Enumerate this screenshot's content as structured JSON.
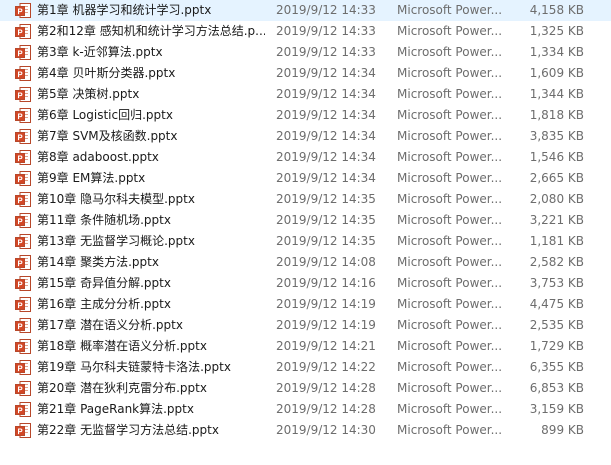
{
  "files": [
    {
      "name": "第1章 机器学习和统计学习.pptx",
      "date": "2019/9/12 14:33",
      "type": "Microsoft Power...",
      "size": "4,158 KB"
    },
    {
      "name": "第2和12章 感知机和统计学习方法总结.p...",
      "date": "2019/9/12 14:33",
      "type": "Microsoft Power...",
      "size": "1,325 KB"
    },
    {
      "name": "第3章 k-近邻算法.pptx",
      "date": "2019/9/12 14:33",
      "type": "Microsoft Power...",
      "size": "1,334 KB"
    },
    {
      "name": "第4章 贝叶斯分类器.pptx",
      "date": "2019/9/12 14:34",
      "type": "Microsoft Power...",
      "size": "1,609 KB"
    },
    {
      "name": "第5章 决策树.pptx",
      "date": "2019/9/12 14:34",
      "type": "Microsoft Power...",
      "size": "1,344 KB"
    },
    {
      "name": "第6章 Logistic回归.pptx",
      "date": "2019/9/12 14:34",
      "type": "Microsoft Power...",
      "size": "1,818 KB"
    },
    {
      "name": "第7章 SVM及核函数.pptx",
      "date": "2019/9/12 14:34",
      "type": "Microsoft Power...",
      "size": "3,835 KB"
    },
    {
      "name": "第8章 adaboost.pptx",
      "date": "2019/9/12 14:34",
      "type": "Microsoft Power...",
      "size": "1,546 KB"
    },
    {
      "name": "第9章 EM算法.pptx",
      "date": "2019/9/12 14:34",
      "type": "Microsoft Power...",
      "size": "2,665 KB"
    },
    {
      "name": "第10章 隐马尔科夫模型.pptx",
      "date": "2019/9/12 14:35",
      "type": "Microsoft Power...",
      "size": "2,080 KB"
    },
    {
      "name": "第11章 条件随机场.pptx",
      "date": "2019/9/12 14:35",
      "type": "Microsoft Power...",
      "size": "3,221 KB"
    },
    {
      "name": "第13章 无监督学习概论.pptx",
      "date": "2019/9/12 14:35",
      "type": "Microsoft Power...",
      "size": "1,181 KB"
    },
    {
      "name": "第14章 聚类方法.pptx",
      "date": "2019/9/12 14:08",
      "type": "Microsoft Power...",
      "size": "2,582 KB"
    },
    {
      "name": "第15章 奇异值分解.pptx",
      "date": "2019/9/12 14:16",
      "type": "Microsoft Power...",
      "size": "3,753 KB"
    },
    {
      "name": "第16章 主成分分析.pptx",
      "date": "2019/9/12 14:19",
      "type": "Microsoft Power...",
      "size": "4,475 KB"
    },
    {
      "name": "第17章 潜在语义分析.pptx",
      "date": "2019/9/12 14:19",
      "type": "Microsoft Power...",
      "size": "2,535 KB"
    },
    {
      "name": "第18章  概率潜在语义分析.pptx",
      "date": "2019/9/12 14:21",
      "type": "Microsoft Power...",
      "size": "1,729 KB"
    },
    {
      "name": "第19章  马尔科夫链蒙特卡洛法.pptx",
      "date": "2019/9/12 14:22",
      "type": "Microsoft Power...",
      "size": "6,355 KB"
    },
    {
      "name": "第20章  潜在狄利克雷分布.pptx",
      "date": "2019/9/12 14:28",
      "type": "Microsoft Power...",
      "size": "6,853 KB"
    },
    {
      "name": "第21章 PageRank算法.pptx",
      "date": "2019/9/12 14:28",
      "type": "Microsoft Power...",
      "size": "3,159 KB"
    },
    {
      "name": "第22章 无监督学习方法总结.pptx",
      "date": "2019/9/12 14:30",
      "type": "Microsoft Power...",
      "size": "899 KB"
    }
  ],
  "icon": {
    "name": "powerpoint-file-icon",
    "color": "#d24726"
  }
}
